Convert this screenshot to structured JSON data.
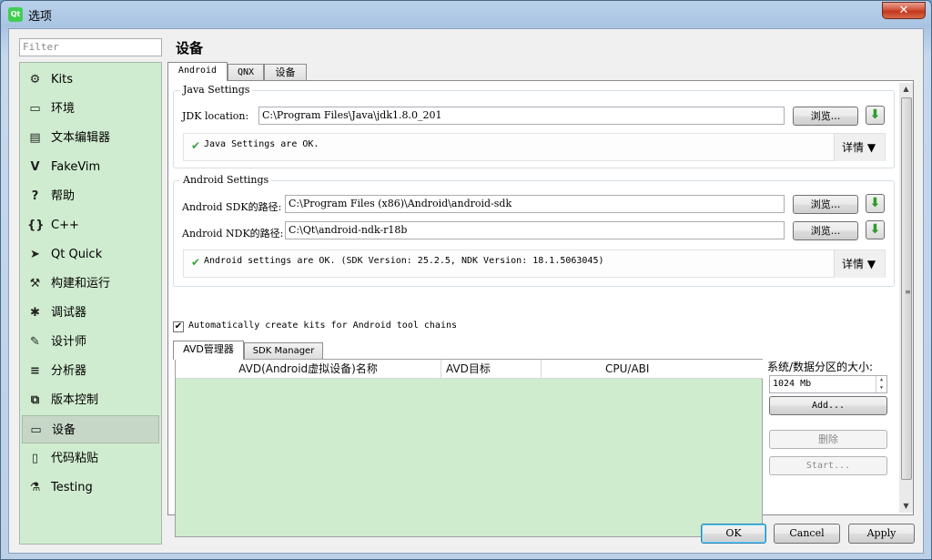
{
  "window": {
    "title": "选项",
    "app_icon": "qt-icon",
    "close_label": "✕"
  },
  "filter": {
    "placeholder": "Filter"
  },
  "sidebar": {
    "items": [
      {
        "label": "Kits",
        "icon": "kits-icon",
        "glyph": "⚙"
      },
      {
        "label": "环境",
        "icon": "monitor-icon",
        "glyph": "▭"
      },
      {
        "label": "文本编辑器",
        "icon": "text-editor-icon",
        "glyph": "▤"
      },
      {
        "label": "FakeVim",
        "icon": "fakevim-icon",
        "glyph": "V"
      },
      {
        "label": "帮助",
        "icon": "help-icon",
        "glyph": "?"
      },
      {
        "label": "C++",
        "icon": "cpp-braces-icon",
        "glyph": "{}"
      },
      {
        "label": "Qt Quick",
        "icon": "qt-quick-icon",
        "glyph": "➤"
      },
      {
        "label": "构建和运行",
        "icon": "hammer-icon",
        "glyph": "⚒"
      },
      {
        "label": "调试器",
        "icon": "bug-icon",
        "glyph": "✱"
      },
      {
        "label": "设计师",
        "icon": "pencil-icon",
        "glyph": "✎"
      },
      {
        "label": "分析器",
        "icon": "analyzer-icon",
        "glyph": "≡"
      },
      {
        "label": "版本控制",
        "icon": "version-control-icon",
        "glyph": "⧉"
      },
      {
        "label": "设备",
        "icon": "devices-icon",
        "glyph": "▭"
      },
      {
        "label": "代码粘贴",
        "icon": "code-paste-icon",
        "glyph": "▯"
      },
      {
        "label": "Testing",
        "icon": "flask-icon",
        "glyph": "⚗"
      }
    ],
    "active_index": 12
  },
  "page": {
    "title": "设备"
  },
  "tabs": [
    "Android",
    "QNX",
    "设备"
  ],
  "java": {
    "group_title": "Java Settings",
    "jdk_label": "JDK location:",
    "jdk_value": "C:\\Program Files\\Java\\jdk1.8.0_201",
    "browse": "浏览...",
    "status": "Java Settings are OK.",
    "details": "详情"
  },
  "android": {
    "group_title": "Android Settings",
    "sdk_label": "Android SDK的路径:",
    "sdk_value": "C:\\Program Files (x86)\\Android\\android-sdk",
    "ndk_label": "Android NDK的路径:",
    "ndk_value": "C:\\Qt\\android-ndk-r18b",
    "browse": "浏览...",
    "status": "Android settings are OK.  (SDK Version: 25.2.5, NDK Version: 18.1.5063045)",
    "details": "详情"
  },
  "auto_kits": {
    "label": "Automatically create kits for Android tool chains",
    "checked": true
  },
  "avd": {
    "tabs": [
      "AVD管理器",
      "SDK Manager"
    ],
    "columns": [
      "AVD(Android虚拟设备)名称",
      "AVD目标",
      "CPU/ABI"
    ],
    "partition_label": "系统/数据分区的大小:",
    "partition_value": "1024 Mb",
    "add": "Add...",
    "remove": "删除",
    "start": "Start..."
  },
  "dialog": {
    "ok": "OK",
    "cancel": "Cancel",
    "apply": "Apply"
  },
  "colors": {
    "sidebar_bg": "#d0ecd0",
    "table_bg": "#cfeccf",
    "accent": "#3aa53a"
  }
}
